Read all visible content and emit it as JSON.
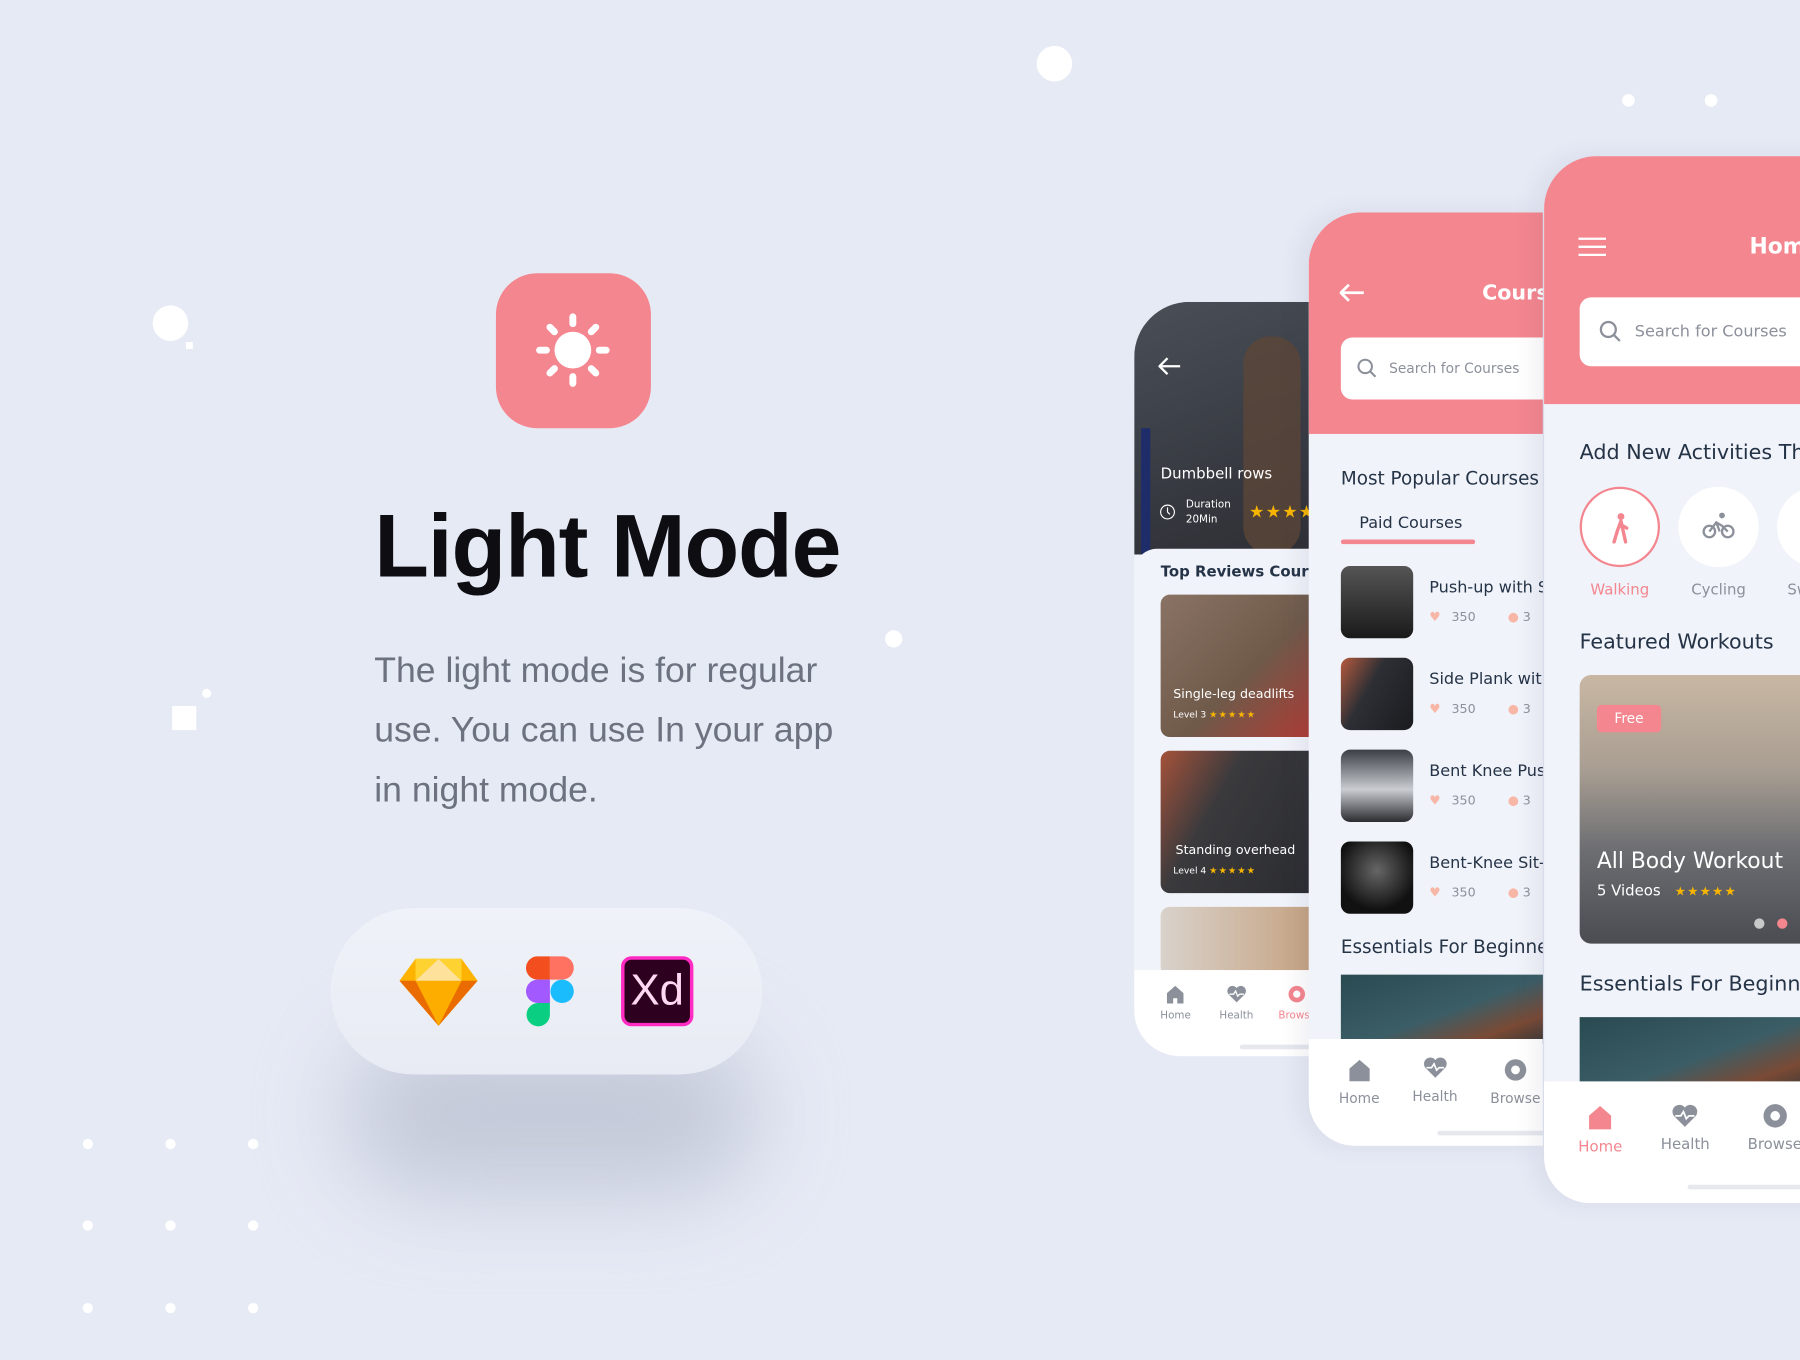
{
  "hero": {
    "title": "Light Mode",
    "description_lines": [
      "The light mode is for regular",
      "use. You can use In your app",
      "in night mode."
    ],
    "app_icon": "sun-icon",
    "tools": [
      "sketch-logo",
      "figma-logo",
      "adobe-xd-logo"
    ],
    "xd_label": "Xd"
  },
  "colors": {
    "accent": "#f4868f",
    "background": "#e6eaf5",
    "text_dark": "#253347",
    "star": "#f7b500"
  },
  "workout_screen": {
    "hero_title": "Dumbbell rows",
    "duration_label": "Duration",
    "duration_value": "20Min",
    "section_title": "Top Reviews Courses",
    "cards": [
      {
        "title": "Single-leg deadlifts",
        "level": "Level 3",
        "rating": 5
      },
      {
        "title": "Standing overhead",
        "level": "Level 4",
        "rating": 5
      }
    ],
    "nav": [
      "Home",
      "Health",
      "Browse"
    ]
  },
  "courses_screen": {
    "title": "Courses",
    "search_placeholder": "Search for Courses",
    "section_title": "Most Popular Courses",
    "tab": "Paid Courses",
    "items": [
      {
        "title": "Push-up with S",
        "likes": "350",
        "time": "3"
      },
      {
        "title": "Side Plank with",
        "likes": "350",
        "time": "3"
      },
      {
        "title": "Bent Knee Push",
        "likes": "350",
        "time": "3"
      },
      {
        "title": "Bent-Knee Sit-",
        "likes": "350",
        "time": "3"
      }
    ],
    "essentials_title": "Essentials For Beginne",
    "nav": [
      "Home",
      "Health",
      "Browse"
    ]
  },
  "home_screen": {
    "title": "Home",
    "search_placeholder": "Search for Courses",
    "activities_title": "Add New Activities Thi",
    "activities": [
      "Walking",
      "Cycling",
      "Sw"
    ],
    "featured_title": "Featured Workouts",
    "featured": {
      "badge": "Free",
      "title": "All Body Workout",
      "videos": "5 Videos",
      "rating": 5
    },
    "essentials_title": "Essentials For Beginne",
    "nav": [
      "Home",
      "Health",
      "Browse"
    ]
  }
}
